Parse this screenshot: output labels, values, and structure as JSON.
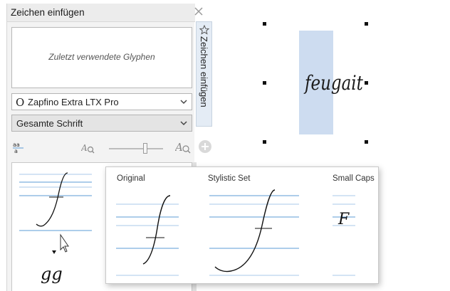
{
  "docker": {
    "title": "Zeichen einfügen",
    "recent_glyphs_placeholder": "Zuletzt verwendete Glyphen",
    "font_dropdown": "Zapfino Extra LTX Pro",
    "font_icon_glyph": "O",
    "filter_dropdown": "Gesamte Schrift",
    "tab_label": "Zeichen einfügen"
  },
  "popup": {
    "labels": [
      "Original",
      "Stylistic Set",
      "Small Caps"
    ]
  },
  "canvas": {
    "text": "feugait"
  },
  "colors": {
    "guide_blue": "#5b9bd5",
    "guide_light": "#a8c8e8",
    "selection_fill": "#cddcf0",
    "tab_bg": "#e4ecf5"
  }
}
